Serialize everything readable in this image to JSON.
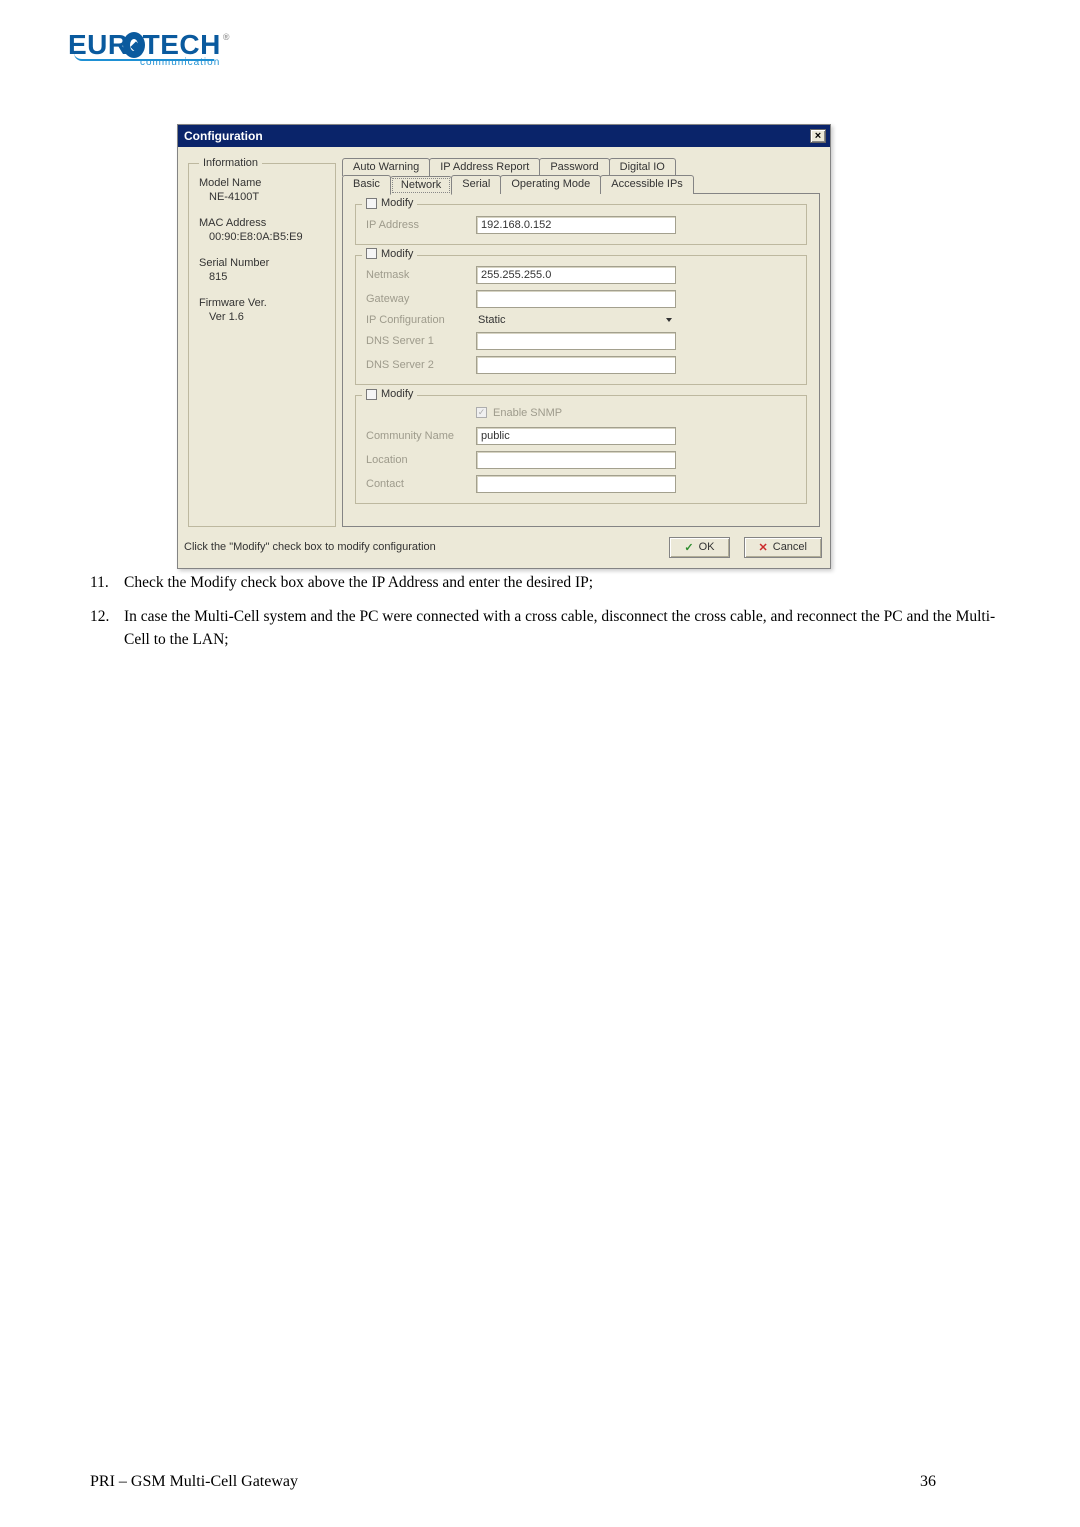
{
  "logo": {
    "brand_eu": "EU",
    "brand_r": "R",
    "brand_tech": "TECH",
    "reg": "®",
    "sub": "communication"
  },
  "dialog": {
    "title": "Configuration",
    "close": "×",
    "info": {
      "legend": "Information",
      "model_name_label": "Model Name",
      "model_name_value": "NE-4100T",
      "mac_label": "MAC Address",
      "mac_value": "00:90:E8:0A:B5:E9",
      "serial_label": "Serial Number",
      "serial_value": "815",
      "fw_label": "Firmware Ver.",
      "fw_value": "Ver 1.6"
    },
    "tabs": {
      "back": [
        "Auto Warning",
        "IP Address Report",
        "Password",
        "Digital IO"
      ],
      "front": [
        "Basic",
        "Network",
        "Serial",
        "Operating Mode",
        "Accessible IPs"
      ],
      "active": "Network"
    },
    "grp1": {
      "modify": "Modify",
      "ip_label": "IP Address",
      "ip_value": "192.168.0.152"
    },
    "grp2": {
      "modify": "Modify",
      "netmask_label": "Netmask",
      "netmask_value": "255.255.255.0",
      "gateway_label": "Gateway",
      "gateway_value": "",
      "ipcfg_label": "IP Configuration",
      "ipcfg_value": "Static",
      "dns1_label": "DNS Server 1",
      "dns1_value": "",
      "dns2_label": "DNS Server 2",
      "dns2_value": ""
    },
    "grp3": {
      "modify": "Modify",
      "enable_snmp": "Enable SNMP",
      "community_label": "Community Name",
      "community_value": "public",
      "location_label": "Location",
      "location_value": "",
      "contact_label": "Contact",
      "contact_value": ""
    },
    "hint": "Click the \"Modify\" check box to modify configuration",
    "ok": "OK",
    "cancel": "Cancel"
  },
  "steps": {
    "n11": "11.",
    "t11": "Check the Modify check box above the IP Address and enter the desired IP;",
    "n12": "12.",
    "t12": "In case the Multi-Cell system and the PC were connected with a cross cable, disconnect the cross cable, and reconnect the PC and the Multi-Cell to the LAN;"
  },
  "footer": {
    "left": "PRI – GSM Multi-Cell Gateway",
    "page": "36"
  }
}
